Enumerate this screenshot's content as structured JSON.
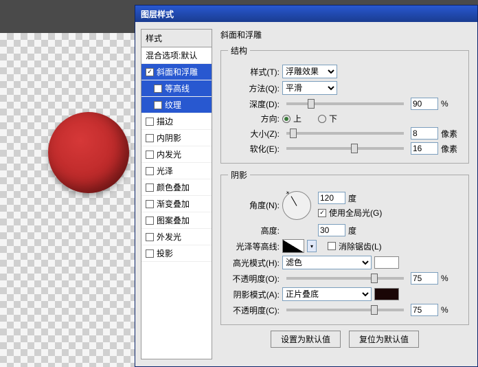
{
  "dialog": {
    "title": "图层样式"
  },
  "styles": {
    "header": "样式",
    "blending": "混合选项:默认",
    "items": [
      {
        "label": "斜面和浮雕",
        "checked": true,
        "selected": true
      },
      {
        "label": "等高线",
        "checked": false,
        "indent": true,
        "selected": true
      },
      {
        "label": "纹理",
        "checked": false,
        "indent": true,
        "selected": true
      },
      {
        "label": "描边",
        "checked": false
      },
      {
        "label": "内阴影",
        "checked": false
      },
      {
        "label": "内发光",
        "checked": false
      },
      {
        "label": "光泽",
        "checked": false
      },
      {
        "label": "颜色叠加",
        "checked": false
      },
      {
        "label": "渐变叠加",
        "checked": false
      },
      {
        "label": "图案叠加",
        "checked": false
      },
      {
        "label": "外发光",
        "checked": false
      },
      {
        "label": "投影",
        "checked": false
      }
    ]
  },
  "panel": {
    "title": "斜面和浮雕",
    "structure": {
      "legend": "结构",
      "style_label": "样式(T):",
      "style_value": "浮雕效果",
      "technique_label": "方法(Q):",
      "technique_value": "平滑",
      "depth_label": "深度(D):",
      "depth_value": "90",
      "depth_unit": "%",
      "direction_label": "方向:",
      "up": "上",
      "down": "下",
      "size_label": "大小(Z):",
      "size_value": "8",
      "size_unit": "像素",
      "soften_label": "软化(E):",
      "soften_value": "16",
      "soften_unit": "像素"
    },
    "shading": {
      "legend": "阴影",
      "angle_label": "角度(N):",
      "angle_value": "120",
      "angle_unit": "度",
      "global_label": "使用全局光(G)",
      "altitude_label": "高度:",
      "altitude_value": "30",
      "altitude_unit": "度",
      "contour_label": "光泽等高线:",
      "antialias_label": "消除锯齿(L)",
      "highlight_mode_label": "高光模式(H):",
      "highlight_mode_value": "滤色",
      "highlight_color": "#ffffff",
      "highlight_opacity_label": "不透明度(O):",
      "highlight_opacity_value": "75",
      "highlight_opacity_unit": "%",
      "shadow_mode_label": "阴影模式(A):",
      "shadow_mode_value": "正片叠底",
      "shadow_color": "#1a0606",
      "shadow_opacity_label": "不透明度(C):",
      "shadow_opacity_value": "75",
      "shadow_opacity_unit": "%"
    },
    "buttons": {
      "default": "设置为默认值",
      "reset": "复位为默认值"
    }
  }
}
